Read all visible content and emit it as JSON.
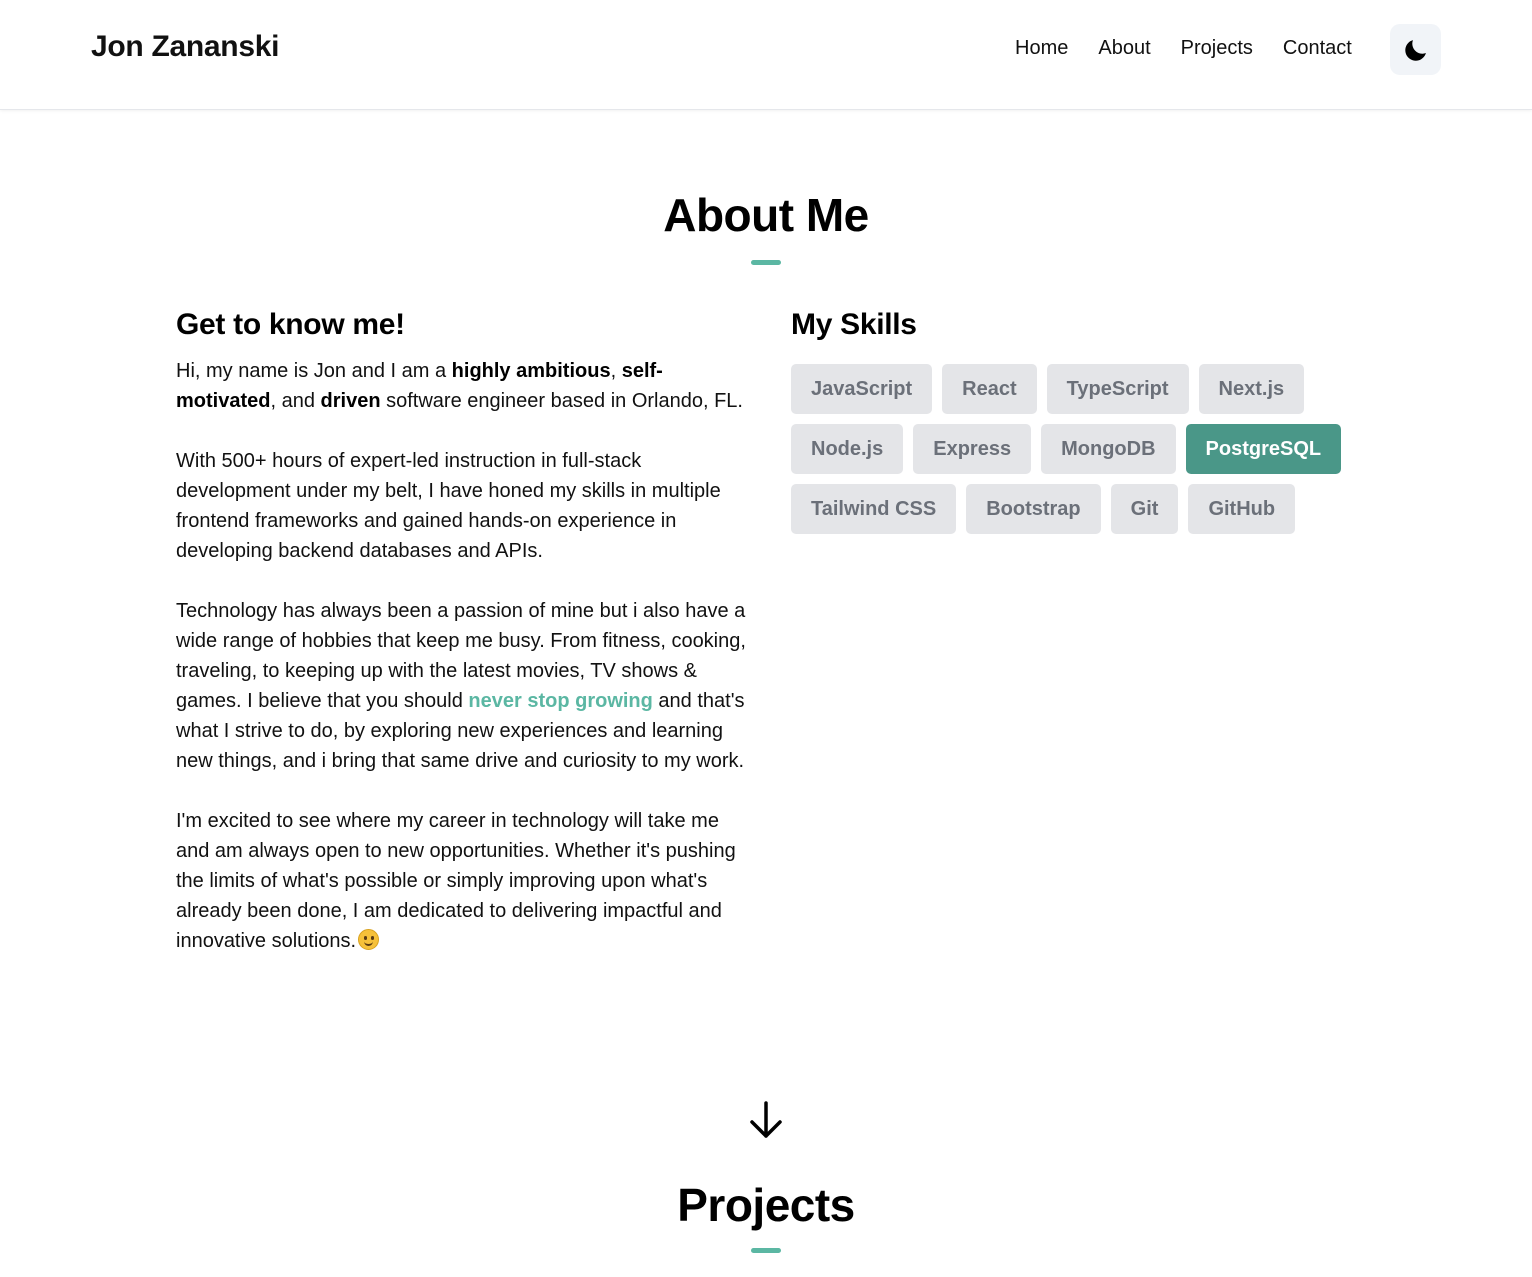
{
  "header": {
    "brand": "Jon Zananski",
    "nav": [
      "Home",
      "About",
      "Projects",
      "Contact"
    ],
    "theme_toggle_icon": "moon-icon"
  },
  "about": {
    "title": "About Me",
    "accent_color": "#5bb7a3",
    "intro_heading": "Get to know me!",
    "p1": {
      "t1": "Hi, my name is Jon and I am a ",
      "b1": "highly ambitious",
      "t2": ", ",
      "b2": "self-motivated",
      "t3": ", and ",
      "b3": "driven",
      "t4": " software engineer based in Orlando, FL."
    },
    "p2": "With 500+ hours of expert-led instruction in full-stack development under my belt, I have honed my skills in multiple frontend frameworks and gained hands-on experience in developing backend databases and APIs.",
    "p3": {
      "t1": "Technology has always been a passion of mine but i also have a wide range of hobbies that keep me busy. From fitness, cooking, traveling, to keeping up with the latest movies, TV shows & games. I believe that you should ",
      "highlight": "never stop growing",
      "t2": " and that's what I strive to do, by exploring new experiences and learning new things, and i bring that same drive and curiosity to my work."
    },
    "p4": "I'm excited to see where my career in technology will take me and am always open to new opportunities. Whether it's pushing the limits of what's possible or simply improving upon what's already been done, I am dedicated to delivering impactful and innovative solutions.",
    "p4_emoji": "smiling-face-icon",
    "skills_heading": "My Skills",
    "skills": [
      "JavaScript",
      "React",
      "TypeScript",
      "Next.js",
      "Node.js",
      "Express",
      "MongoDB",
      "PostgreSQL",
      "Tailwind CSS",
      "Bootstrap",
      "Git",
      "GitHub"
    ],
    "active_skill": "PostgreSQL",
    "active_skill_color": "#4a9788"
  },
  "scroll_icon": "arrow-down-icon",
  "projects": {
    "title": "Projects"
  }
}
